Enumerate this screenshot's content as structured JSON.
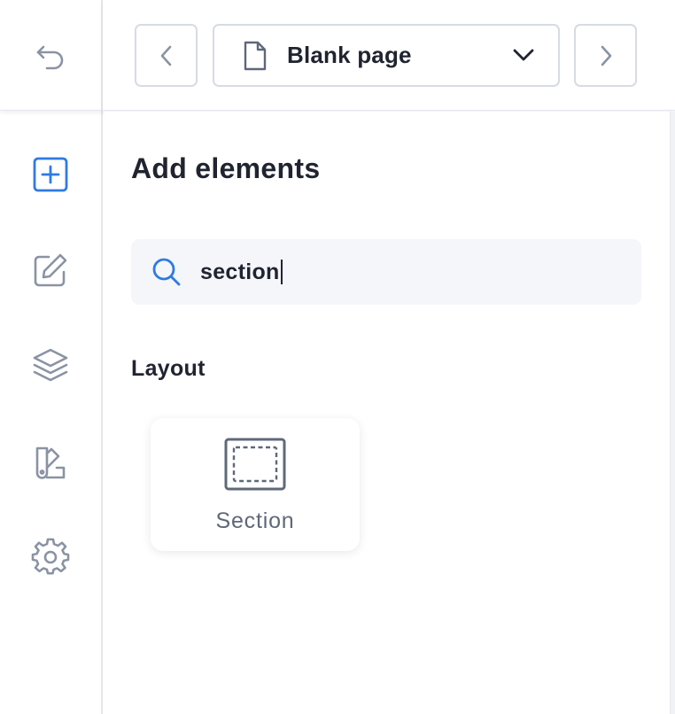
{
  "toolbar": {
    "page_selector_label": "Blank page"
  },
  "rail": {
    "items": [
      {
        "name": "undo",
        "icon": "undo-icon"
      },
      {
        "name": "add-elements",
        "icon": "plus-square-icon",
        "active": true
      },
      {
        "name": "edit",
        "icon": "edit-icon"
      },
      {
        "name": "layers",
        "icon": "layers-icon"
      },
      {
        "name": "theme",
        "icon": "palette-icon"
      },
      {
        "name": "settings",
        "icon": "gear-icon"
      }
    ]
  },
  "panel": {
    "title": "Add elements",
    "search": {
      "value": "section"
    },
    "groups": [
      {
        "label": "Layout",
        "items": [
          {
            "label": "Section",
            "icon": "section-icon"
          }
        ]
      }
    ]
  },
  "colors": {
    "accent": "#2e7be0",
    "icon_gray": "#8a93a3",
    "text_dark": "#1f2430",
    "card_label": "#5e6878",
    "search_bg": "#f4f6fa",
    "border": "#d7dbe3"
  }
}
